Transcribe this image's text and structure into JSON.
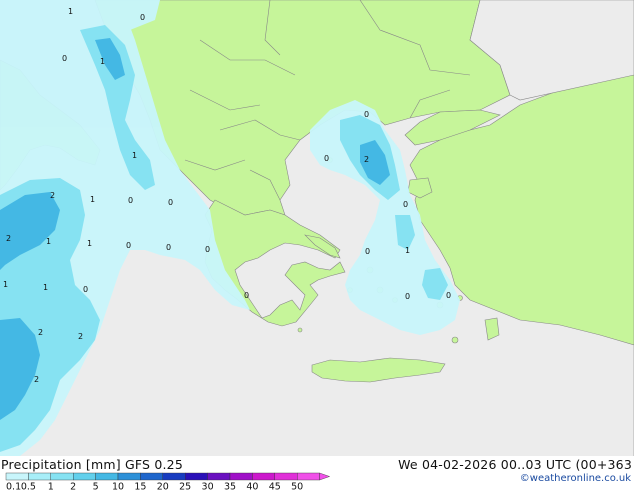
{
  "footer": {
    "title": "Precipitation [mm]  GFS 0.25",
    "time": "We 04-02-2026 00..03 UTC (00+363",
    "credit": "©weatheronline.co.uk"
  },
  "legend": {
    "ticks": [
      "0.1",
      "0.5",
      "1",
      "2",
      "5",
      "10",
      "15",
      "20",
      "25",
      "30",
      "35",
      "40",
      "45",
      "50"
    ],
    "colors": [
      "#c8f5fb",
      "#a8eef8",
      "#86e2f2",
      "#62d0ec",
      "#44b8e4",
      "#2c90d8",
      "#1f66cc",
      "#183cc0",
      "#2a10b8",
      "#6a10c0",
      "#a010c8",
      "#cc18cc",
      "#e030d8",
      "#f050e8"
    ]
  },
  "map": {
    "colors": {
      "sea": "#ececec",
      "land": "#c6f59a",
      "border": "#888888",
      "coast": "#888888",
      "precip_light": "#c8f5fb",
      "precip_mid": "#86e2f2",
      "precip_heavy": "#44b8e4"
    },
    "labels": [
      {
        "id": "l1",
        "text": "1"
      },
      {
        "id": "l2",
        "text": "0"
      },
      {
        "id": "l3",
        "text": "0"
      },
      {
        "id": "l4",
        "text": "1"
      },
      {
        "id": "l5",
        "text": "1"
      },
      {
        "id": "l6",
        "text": "2"
      },
      {
        "id": "l7",
        "text": "1"
      },
      {
        "id": "l8",
        "text": "0"
      },
      {
        "id": "l9",
        "text": "0"
      },
      {
        "id": "l10",
        "text": "2"
      },
      {
        "id": "l11",
        "text": "1"
      },
      {
        "id": "l12",
        "text": "1"
      },
      {
        "id": "l13",
        "text": "0"
      },
      {
        "id": "l14",
        "text": "0"
      },
      {
        "id": "l15",
        "text": "0"
      },
      {
        "id": "l16",
        "text": "1"
      },
      {
        "id": "l17",
        "text": "1"
      },
      {
        "id": "l18",
        "text": "0"
      },
      {
        "id": "l19",
        "text": "2"
      },
      {
        "id": "l20",
        "text": "2"
      },
      {
        "id": "l21",
        "text": "2"
      },
      {
        "id": "l22",
        "text": "0"
      },
      {
        "id": "l23",
        "text": "0"
      },
      {
        "id": "l24",
        "text": "2"
      },
      {
        "id": "l25",
        "text": "0"
      },
      {
        "id": "l26",
        "text": "0"
      },
      {
        "id": "l27",
        "text": "1"
      },
      {
        "id": "l28",
        "text": "0"
      },
      {
        "id": "l29",
        "text": "0"
      },
      {
        "id": "l30",
        "text": "0"
      }
    ]
  }
}
